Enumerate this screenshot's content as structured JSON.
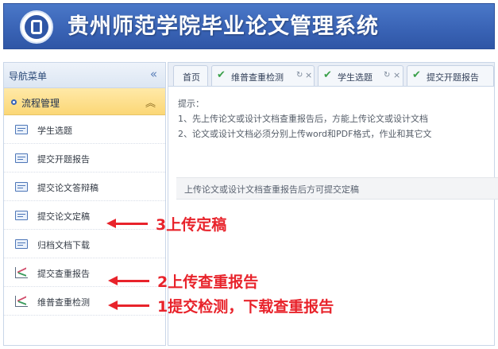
{
  "header": {
    "title": "贵州师范学院毕业论文管理系统"
  },
  "sidebar": {
    "nav_title": "导航菜单",
    "collapse_glyph": "«",
    "group": {
      "label": "流程管理",
      "toggle_glyph": "︽"
    },
    "items": [
      {
        "label": "学生选题",
        "icon": "document-icon"
      },
      {
        "label": "提交开题报告",
        "icon": "document-icon"
      },
      {
        "label": "提交论文答辩稿",
        "icon": "document-icon"
      },
      {
        "label": "提交论文定稿",
        "icon": "document-icon"
      },
      {
        "label": "归档文档下载",
        "icon": "document-icon"
      },
      {
        "label": "提交查重报告",
        "icon": "chart-icon"
      },
      {
        "label": "维普查重检测",
        "icon": "chart-icon"
      }
    ]
  },
  "tabs": [
    {
      "label": "首页",
      "checked": false,
      "closable": false
    },
    {
      "label": "维普查重检测",
      "checked": true,
      "closable": true
    },
    {
      "label": "学生选题",
      "checked": true,
      "closable": true
    },
    {
      "label": "提交开题报告",
      "checked": true,
      "closable": false
    }
  ],
  "tab_glyphs": {
    "check": "✔",
    "refresh": "↻",
    "close": "×"
  },
  "content": {
    "tips_title": "提示：",
    "tips": [
      "1、先上传论文或设计文档查重报告后，方能上传论文或设计文档",
      "2、论文或设计文档必须分别上传word和PDF格式，作业和其它文"
    ],
    "notice": "上传论文或设计文档查重报告后方可提交定稿"
  },
  "annotations": [
    {
      "text": "3上传定稿",
      "color": "#e8232b"
    },
    {
      "text": "2上传查重报告",
      "color": "#e8232b"
    },
    {
      "text": "1提交检测，下载查重报告",
      "color": "#e8232b"
    }
  ],
  "colors": {
    "header_blue": "#3a64b6",
    "group_yellow": "#fbd776",
    "annotation_red": "#e8232b",
    "check_green": "#3aa04a"
  }
}
